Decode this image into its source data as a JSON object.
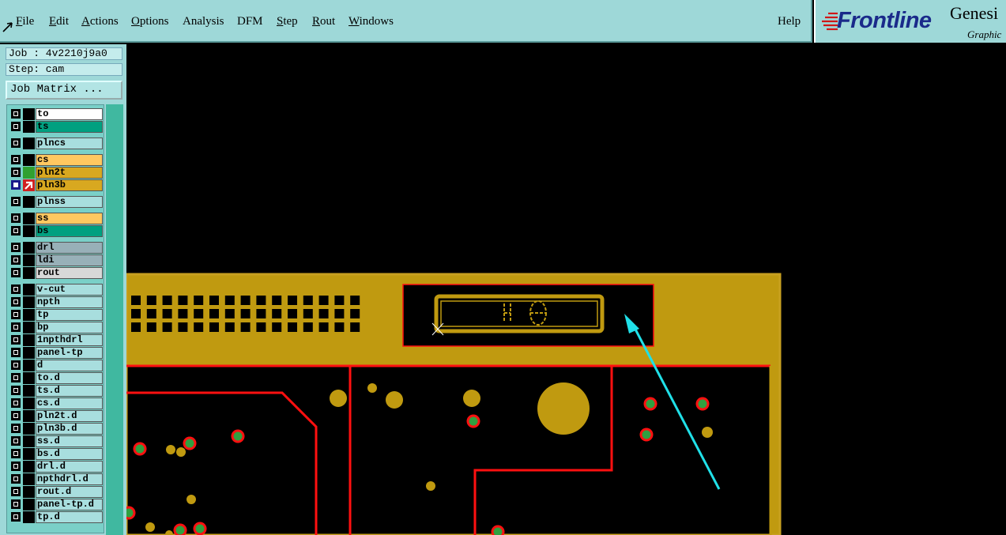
{
  "menu": {
    "file": "File",
    "edit": "Edit",
    "actions": "Actions",
    "options": "Options",
    "analysis": "Analysis",
    "dfm": "DFM",
    "step": "Step",
    "rout": "Rout",
    "windows": "Windows",
    "help": "Help"
  },
  "logo": {
    "brand": "Frontline",
    "product": "Genesi",
    "sub": "Graphic"
  },
  "info": {
    "job": "Job : 4v2210j9a0",
    "step": "Step: cam"
  },
  "job_matrix": "Job Matrix ...",
  "layers": [
    {
      "name": "to",
      "color": "#ffffff",
      "swatch": "#000"
    },
    {
      "name": "ts",
      "color": "#00a080",
      "swatch": "#000"
    },
    {
      "name": "plncs",
      "color": "#a8dede",
      "swatch": "#000"
    },
    {
      "name": "cs",
      "color": "#ffc860",
      "swatch": "#000"
    },
    {
      "name": "pln2t",
      "color": "#d8a820",
      "swatch": "#30a030"
    },
    {
      "name": "pln3b",
      "color": "#d8a820",
      "swatch": "#d02020",
      "selected": true
    },
    {
      "name": "plnss",
      "color": "#a8dede",
      "swatch": "#000"
    },
    {
      "name": "ss",
      "color": "#ffc860",
      "swatch": "#000"
    },
    {
      "name": "bs",
      "color": "#00a080",
      "swatch": "#000"
    },
    {
      "name": "drl",
      "color": "#98b0b8",
      "swatch": "#000"
    },
    {
      "name": "ldi",
      "color": "#98b0b8",
      "swatch": "#000"
    },
    {
      "name": "rout",
      "color": "#d8d8d8",
      "swatch": "#000"
    },
    {
      "name": "v-cut",
      "color": "#a8dede",
      "swatch": "#000"
    },
    {
      "name": "npth",
      "color": "#a8dede",
      "swatch": "#000"
    },
    {
      "name": "tp",
      "color": "#a8dede",
      "swatch": "#000"
    },
    {
      "name": "bp",
      "color": "#a8dede",
      "swatch": "#000"
    },
    {
      "name": "1npthdrl",
      "color": "#a8dede",
      "swatch": "#000"
    },
    {
      "name": "panel-tp",
      "color": "#a8dede",
      "swatch": "#000"
    },
    {
      "name": "d",
      "color": "#a8dede",
      "swatch": "#000"
    },
    {
      "name": "to.d",
      "color": "#a8dede",
      "swatch": "#000"
    },
    {
      "name": "ts.d",
      "color": "#a8dede",
      "swatch": "#000"
    },
    {
      "name": "cs.d",
      "color": "#a8dede",
      "swatch": "#000"
    },
    {
      "name": "pln2t.d",
      "color": "#a8dede",
      "swatch": "#000"
    },
    {
      "name": "pln3b.d",
      "color": "#a8dede",
      "swatch": "#000"
    },
    {
      "name": "ss.d",
      "color": "#a8dede",
      "swatch": "#000"
    },
    {
      "name": "bs.d",
      "color": "#a8dede",
      "swatch": "#000"
    },
    {
      "name": "drl.d",
      "color": "#a8dede",
      "swatch": "#000"
    },
    {
      "name": "npthdrl.d",
      "color": "#a8dede",
      "swatch": "#000"
    },
    {
      "name": "rout.d",
      "color": "#a8dede",
      "swatch": "#000"
    },
    {
      "name": "panel-tp.d",
      "color": "#a8dede",
      "swatch": "#000"
    },
    {
      "name": "tp.d",
      "color": "#a8dede",
      "swatch": "#000"
    }
  ],
  "colors": {
    "copper": "#c09a10",
    "trace": "#ff1010",
    "annotation_arrow": "#20e0e8",
    "pad_green": "#30a040"
  }
}
